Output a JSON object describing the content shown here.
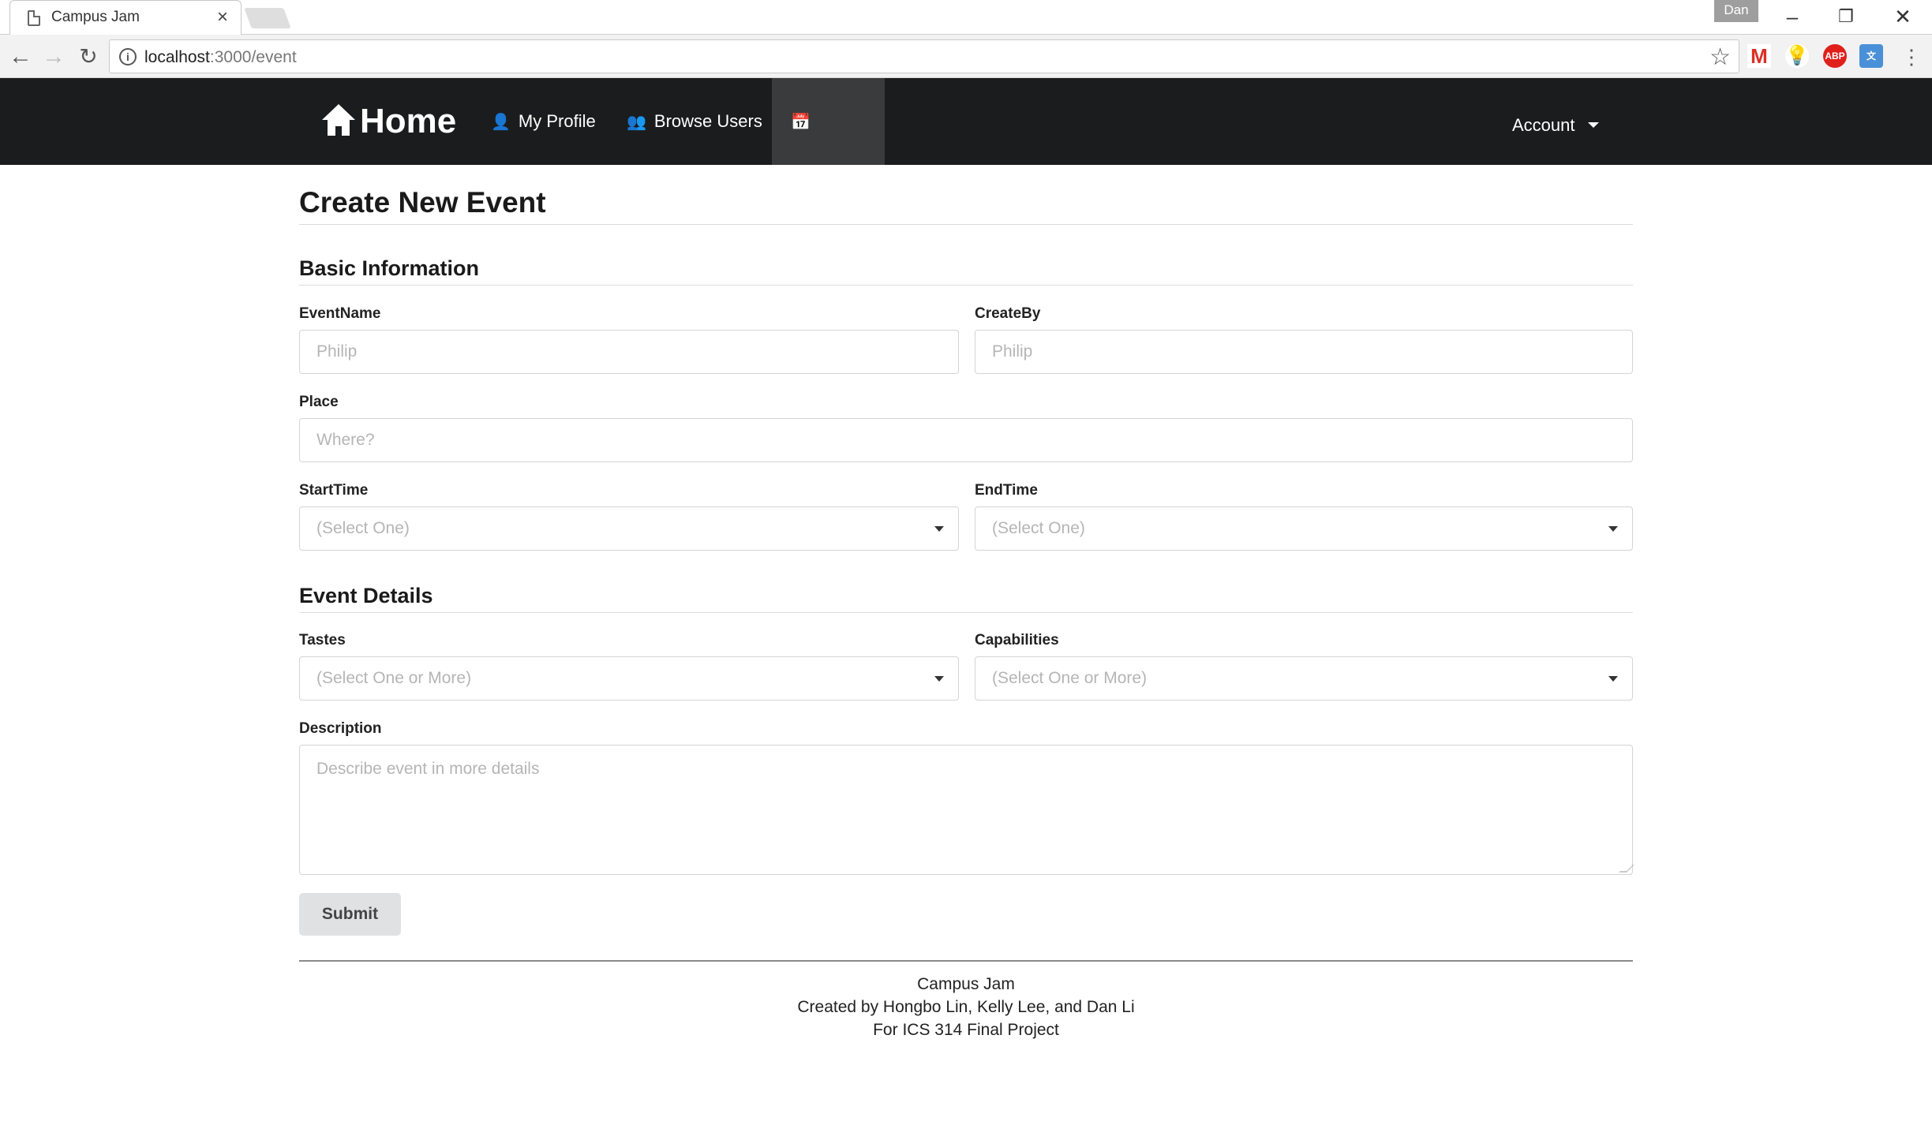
{
  "browser": {
    "tab_title": "Campus Jam",
    "tab_close": "×",
    "profile_name": "Dan",
    "url_host": "localhost",
    "url_path": ":3000/event",
    "extensions": [
      "gmail-icon",
      "lightbulb-icon",
      "adblock-plus-icon",
      "translate-icon"
    ],
    "adblock_label": "ABP"
  },
  "navbar": {
    "home_label": "Home",
    "items": [
      {
        "label": "My Profile",
        "icon": "user-icon"
      },
      {
        "label": "Browse Users",
        "icon": "users-icon"
      },
      {
        "label": "Events",
        "icon": "calendar-icon"
      }
    ],
    "active_item": "Events",
    "account_label": "Account"
  },
  "form": {
    "title": "Create New Event",
    "basic_heading": "Basic Information",
    "event_name": {
      "label": "EventName",
      "placeholder": "Philip"
    },
    "created_by": {
      "label": "CreateBy",
      "placeholder": "Philip"
    },
    "place": {
      "label": "Place",
      "placeholder": "Where?"
    },
    "start_time": {
      "label": "StartTime",
      "placeholder": "(Select One)"
    },
    "end_time": {
      "label": "EndTime",
      "placeholder": "(Select One)"
    },
    "details_heading": "Event Details",
    "tastes": {
      "label": "Tastes",
      "placeholder": "(Select One or More)"
    },
    "capabilities": {
      "label": "Capabilities",
      "placeholder": "(Select One or More)"
    },
    "description": {
      "label": "Description",
      "placeholder": "Describe event in more details"
    },
    "submit_label": "Submit"
  },
  "footer": {
    "line1": "Campus Jam",
    "line2": "Created by Hongbo Lin, Kelly Lee, and Dan Li",
    "line3": "For ICS 314 Final Project"
  },
  "colors": {
    "navbar_bg": "#1b1c1d",
    "active_nav_bg": "#3a3b3c",
    "submit_bg": "#e0e1e2"
  }
}
